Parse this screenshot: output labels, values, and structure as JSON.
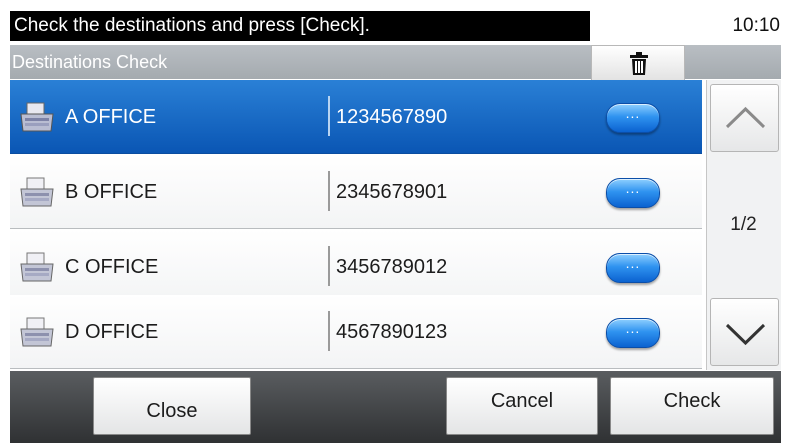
{
  "header": {
    "message": "Check the destinations and press [Check].",
    "clock": "10:10"
  },
  "title_bar": {
    "title": "Destinations Check",
    "delete_icon": "trash-icon"
  },
  "destinations": [
    {
      "name": "A OFFICE",
      "number": "1234567890",
      "selected": true,
      "detail_label": "..."
    },
    {
      "name": "B OFFICE",
      "number": "2345678901",
      "selected": false,
      "detail_label": "..."
    },
    {
      "name": "C OFFICE",
      "number": "3456789012",
      "selected": false,
      "detail_label": "..."
    },
    {
      "name": "D OFFICE",
      "number": "4567890123",
      "selected": false,
      "detail_label": "..."
    }
  ],
  "pagination": {
    "indicator": "1/2",
    "up_icon": "chevron-up-icon",
    "down_icon": "chevron-down-icon"
  },
  "footer": {
    "close_label": "Close",
    "cancel_label": "Cancel",
    "check_label": "Check"
  },
  "colors": {
    "selection": "#0a56b4",
    "header_bg": "#000000",
    "title_bg": "#a4aaaf"
  }
}
